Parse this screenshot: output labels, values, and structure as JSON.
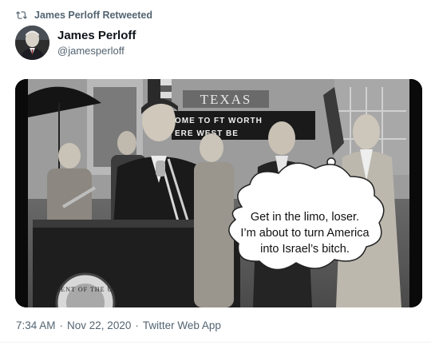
{
  "retweet": {
    "label": "James Perloff Retweeted",
    "icon": "retweet-icon"
  },
  "author": {
    "name": "James Perloff",
    "handle": "@jamesperloff",
    "avatar_icon": "avatar"
  },
  "media": {
    "marquee_title": "TEXAS",
    "marquee_line1": "OME TO FT WORTH",
    "marquee_line2": "ERE   WEST BE",
    "seal_text": "IDENT OF THE UN",
    "speech_bubble": "Get in the limo, loser.\nI’m about to turn America\ninto Israel’s bitch."
  },
  "meta": {
    "time": "7:34 AM",
    "date": "Nov 22, 2020",
    "source": "Twitter Web App",
    "separator": "·"
  },
  "colors": {
    "text_primary": "#0f1419",
    "text_secondary": "#536471",
    "divider": "#eff3f4"
  }
}
